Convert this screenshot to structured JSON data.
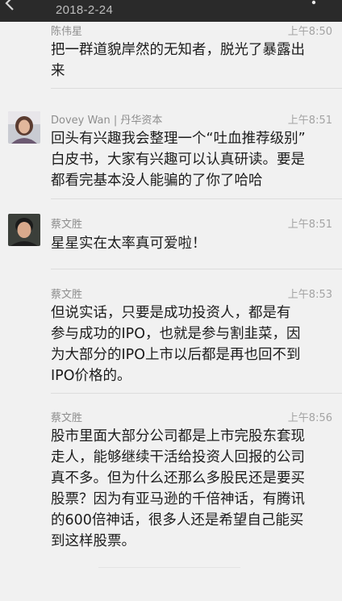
{
  "header": {
    "date": "2018-2-24",
    "back_icon": "back-arrow-icon",
    "more_icon": "more-vertical-icon"
  },
  "messages": [
    {
      "sender": "陈伟星",
      "time": "上午8:50",
      "text": "把一群道貌岸然的无知者，脱光了暴露出\n来"
    },
    {
      "sender": "Dovey Wan | 丹华资本",
      "time": "上午8:51",
      "text": "回头有兴趣我会整理一个“吐血推荐级别”\n白皮书，大家有兴趣可以认真研读。要是\n都看完基本没人能骗的了你了哈哈"
    },
    {
      "sender": "蔡文胜",
      "time": "上午8:51",
      "text": "星星实在太率真可爱啦！"
    },
    {
      "sender": "蔡文胜",
      "time": "上午8:53",
      "text": "但说实话，只要是成功投资人，都是有\n参与成功的IPO，也就是参与割韭菜，因\n为大部分的IPO上市以后都是再也回不到\nIPO价格的。"
    },
    {
      "sender": "蔡文胜",
      "time": "上午8:56",
      "text": "股市里面大部分公司都是上市完股东套现\n走人，能够继续干活给投资人回报的公司\n真不多。但为什么还那么多股民还是要买\n股票？因为有亚马逊的千倍神话，有腾讯\n的600倍神话，很多人还是希望自己能买\n到这样股票。"
    }
  ],
  "colors": {
    "topbar": "#2a2a2a",
    "background": "#f1f1f1",
    "text": "#1c1c1c",
    "meta": "#8e8e8e"
  }
}
